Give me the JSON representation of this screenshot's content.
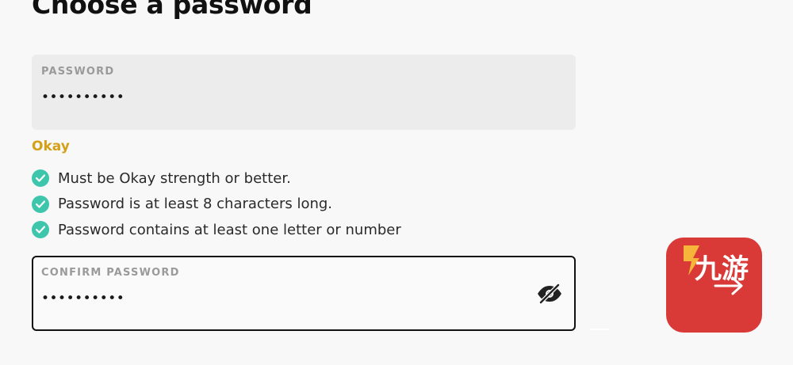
{
  "page": {
    "title": "Choose a password"
  },
  "password_field": {
    "label": "PASSWORD",
    "value": "••••••••••"
  },
  "strength": {
    "label": "Okay",
    "color": "#d4a017"
  },
  "requirements": [
    {
      "text": "Must be Okay strength or better.",
      "met": true
    },
    {
      "text": "Password is at least 8 characters long.",
      "met": true
    },
    {
      "text": "Password contains at least one letter or number",
      "met": true
    }
  ],
  "confirm_field": {
    "label": "CONFIRM PASSWORD",
    "value": "••••••••••",
    "toggle_icon": "eye-slash-icon"
  },
  "app_badge": {
    "text": "九游",
    "color": "#d93a37"
  },
  "colors": {
    "check": "#3ec6ad",
    "border_focus": "#111111"
  }
}
